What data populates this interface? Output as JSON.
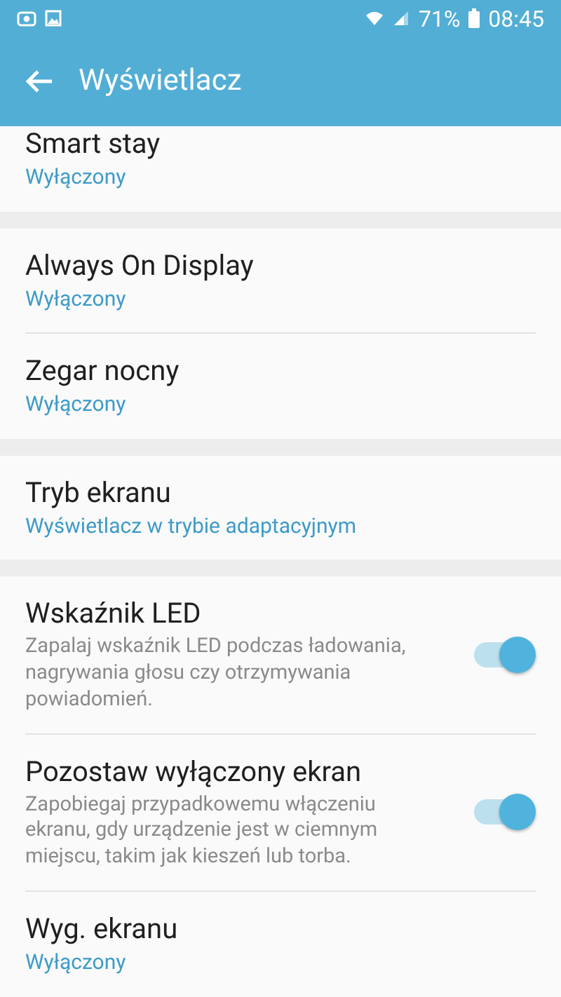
{
  "status_bar": {
    "battery": "71%",
    "time": "08:45"
  },
  "toolbar": {
    "title": "Wyświetlacz"
  },
  "groups": [
    {
      "items": [
        {
          "kind": "summary",
          "title": "Smart stay",
          "summary": "Wyłączony"
        }
      ]
    },
    {
      "items": [
        {
          "kind": "summary",
          "title": "Always On Display",
          "summary": "Wyłączony"
        },
        {
          "kind": "summary",
          "title": "Zegar nocny",
          "summary": "Wyłączony"
        }
      ]
    },
    {
      "items": [
        {
          "kind": "summary",
          "title": "Tryb ekranu",
          "summary": "Wyświetlacz w trybie adaptacyjnym"
        }
      ]
    },
    {
      "items": [
        {
          "kind": "toggle",
          "title": "Wskaźnik LED",
          "summary": "Zapalaj wskaźnik LED podczas ładowania, nagrywania głosu czy otrzymywania powiadomień.",
          "on": true
        },
        {
          "kind": "toggle",
          "title": "Pozostaw wyłączony ekran",
          "summary": "Zapobiegaj przypadkowemu włączeniu ekranu, gdy urządzenie jest w ciemnym miejscu, takim jak kieszeń lub torba.",
          "on": true
        },
        {
          "kind": "summary",
          "title": "Wyg. ekranu",
          "summary": "Wyłączony"
        }
      ]
    }
  ]
}
